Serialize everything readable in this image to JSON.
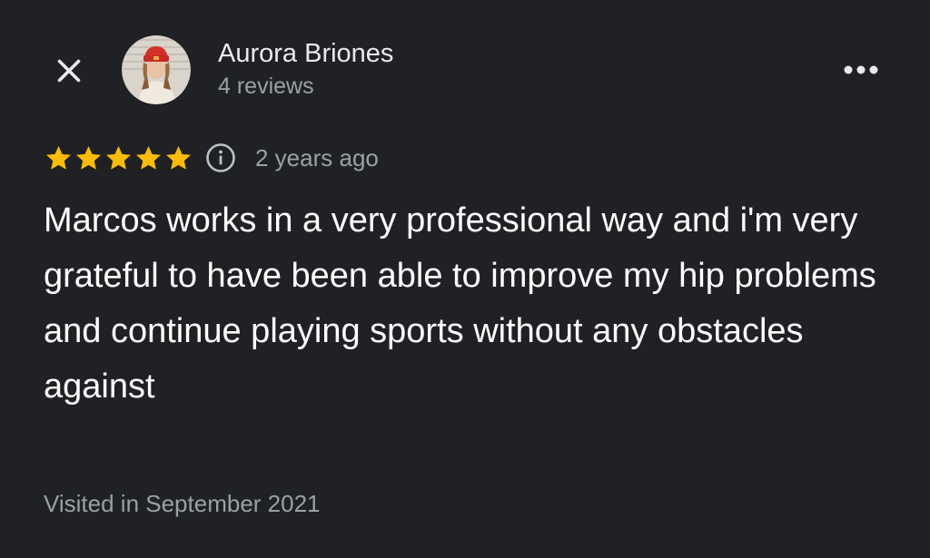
{
  "review": {
    "author_name": "Aurora Briones",
    "author_reviews": "4 reviews",
    "rating": 5,
    "rating_max": 5,
    "timestamp": "2 years ago",
    "text": "Marcos works in a very professional way and i'm very grateful to have been able to improve my hip problems and continue playing sports without any obstacles against",
    "visited": "Visited in September 2021"
  },
  "icons": {
    "close": "close-icon",
    "more": "more-horizontal-icon",
    "star": "star-icon",
    "info": "info-icon"
  },
  "colors": {
    "background": "#202124",
    "star": "#fbbc04",
    "primary_text": "#e8eaed",
    "secondary_text": "#9aa0a6"
  }
}
